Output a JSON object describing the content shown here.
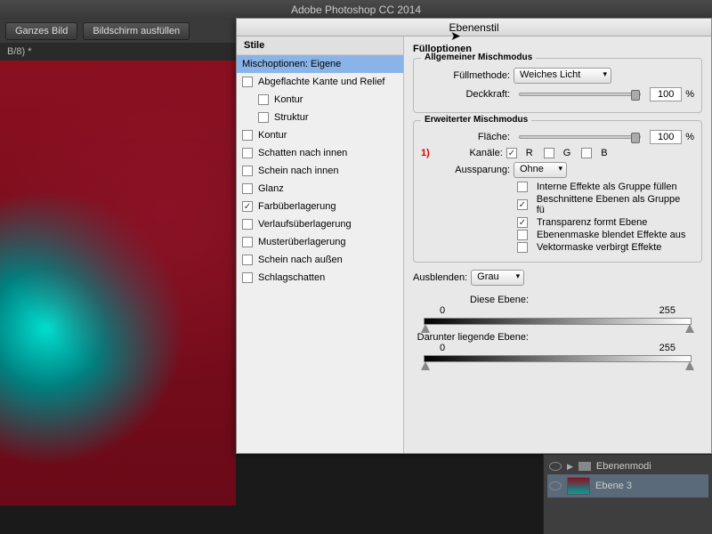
{
  "app_title": "Adobe Photoshop CC 2014",
  "toolbar": {
    "full_image": "Ganzes Bild",
    "fill_screen": "Bildschirm ausfüllen"
  },
  "doc_tab": "B/8) *",
  "dialog_title": "Ebenenstil",
  "styles": {
    "header": "Stile",
    "selected": "Mischoptionen: Eigene",
    "items": [
      {
        "label": "Abgeflachte Kante und Relief",
        "checked": false
      },
      {
        "label": "Kontur",
        "checked": false,
        "sub": true
      },
      {
        "label": "Struktur",
        "checked": false,
        "sub": true
      },
      {
        "label": "Kontur",
        "checked": false
      },
      {
        "label": "Schatten nach innen",
        "checked": false
      },
      {
        "label": "Schein nach innen",
        "checked": false
      },
      {
        "label": "Glanz",
        "checked": false
      },
      {
        "label": "Farbüberlagerung",
        "checked": true
      },
      {
        "label": "Verlaufsüberlagerung",
        "checked": false
      },
      {
        "label": "Musterüberlagerung",
        "checked": false
      },
      {
        "label": "Schein nach außen",
        "checked": false
      },
      {
        "label": "Schlagschatten",
        "checked": false
      }
    ]
  },
  "opts": {
    "fill_options": "Fülloptionen",
    "general_blend": "Allgemeiner Mischmodus",
    "fill_method_label": "Füllmethode:",
    "fill_method_value": "Weiches Licht",
    "opacity_label": "Deckkraft:",
    "opacity_value": "100",
    "percent": "%",
    "adv_blend": "Erweiterter Mischmodus",
    "area_label": "Fläche:",
    "area_value": "100",
    "marker": "1)",
    "channels_label": "Kanäle:",
    "ch_r": "R",
    "ch_g": "G",
    "ch_b": "B",
    "knockout_label": "Aussparung:",
    "knockout_value": "Ohne",
    "cb1": "Interne Effekte als Gruppe füllen",
    "cb2": "Beschnittene Ebenen als Gruppe fü",
    "cb3": "Transparenz formt Ebene",
    "cb4": "Ebenenmaske blendet Effekte aus",
    "cb5": "Vektormaske verbirgt Effekte",
    "blendif_label": "Ausblenden:",
    "blendif_value": "Grau",
    "this_layer": "Diese Ebene:",
    "under_layer": "Darunter liegende Ebene:",
    "v0": "0",
    "v255": "255"
  },
  "layers": {
    "group": "Ebenenmodi",
    "layer3": "Ebene 3"
  }
}
